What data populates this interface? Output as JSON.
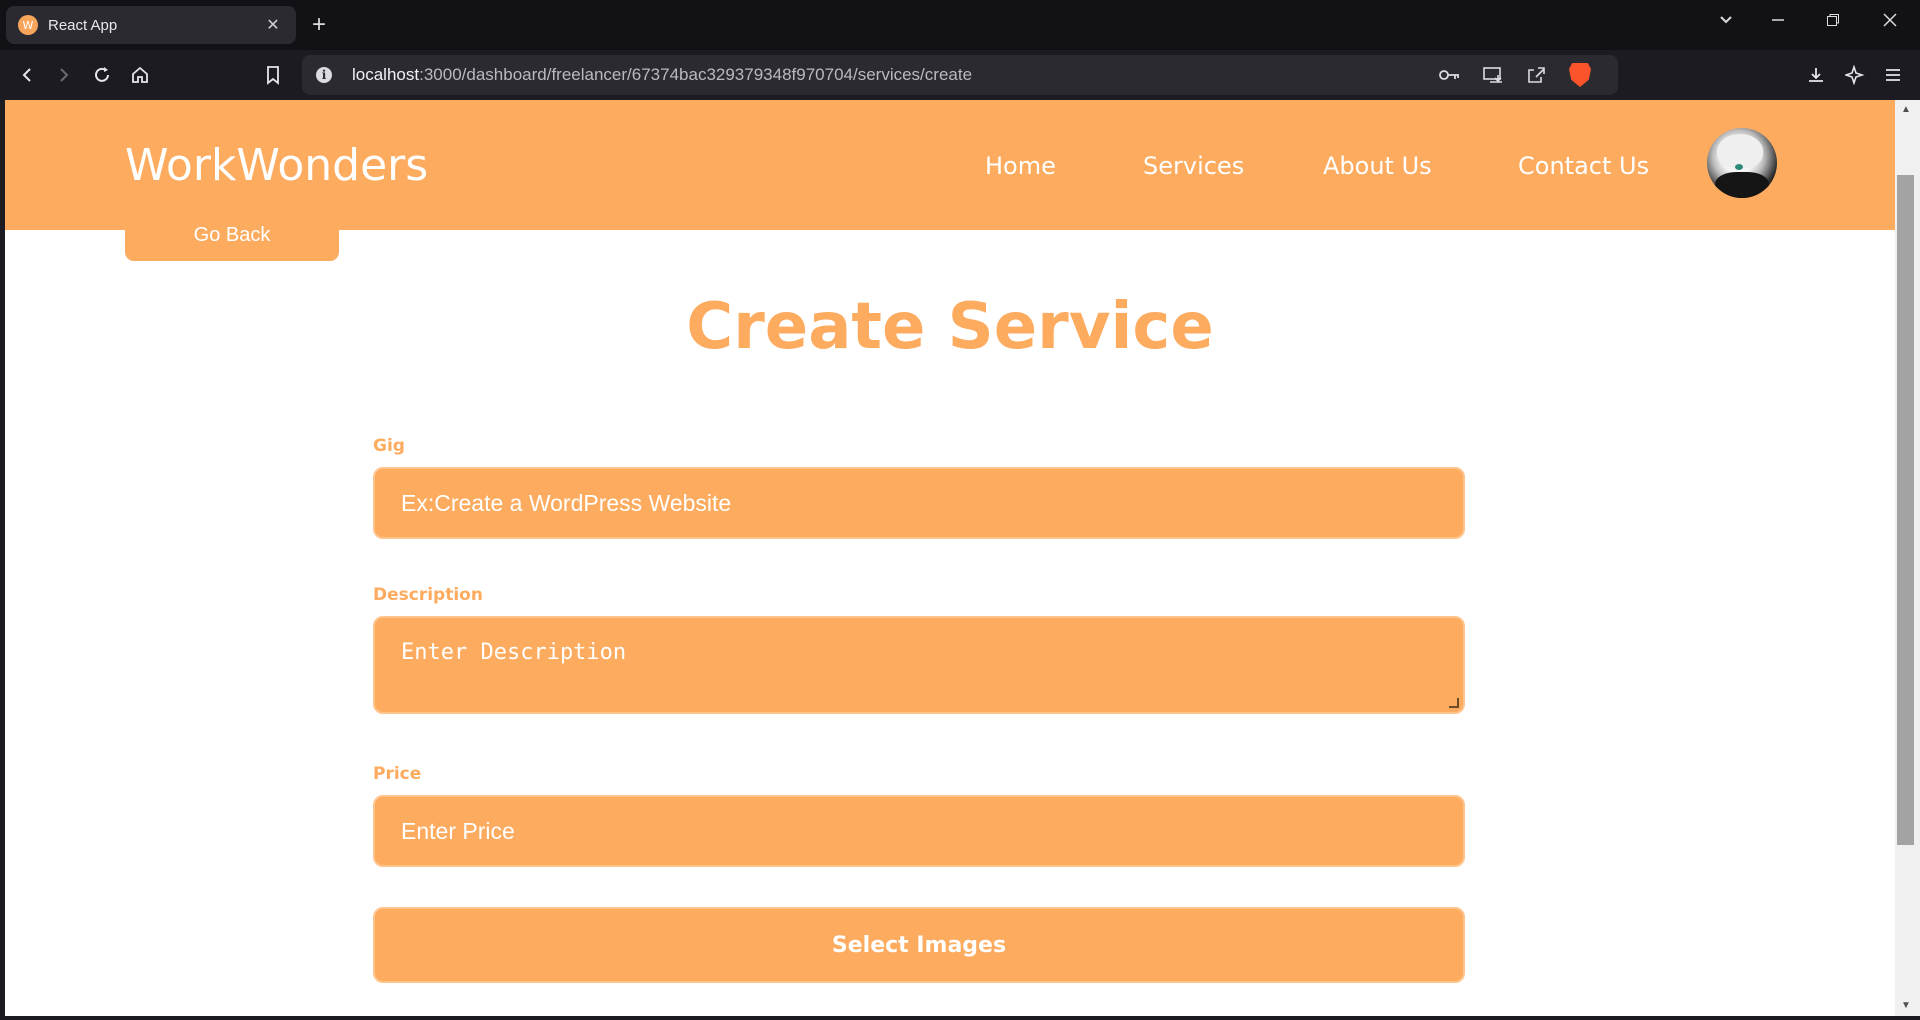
{
  "browser": {
    "tab": {
      "title": "React App",
      "favicon_letter": "W"
    },
    "url": {
      "host": "localhost",
      "path": ":3000/dashboard/freelancer/67374bac329379348f970704/services/create"
    }
  },
  "site": {
    "brand": "WorkWonders",
    "nav": [
      {
        "label": "Home"
      },
      {
        "label": "Services"
      },
      {
        "label": "About Us"
      },
      {
        "label": "Contact Us"
      }
    ]
  },
  "page": {
    "go_back": "Go Back",
    "title": "Create Service",
    "form": {
      "gig": {
        "label": "Gig",
        "placeholder": "Ex:Create a WordPress Website"
      },
      "description": {
        "label": "Description",
        "placeholder": "Enter Description"
      },
      "price": {
        "label": "Price",
        "placeholder": "Enter Price"
      },
      "select_images": "Select Images"
    }
  },
  "colors": {
    "accent": "#fdab5f",
    "page_bg": "#ffffff",
    "chrome_bg": "#1c1b22"
  }
}
